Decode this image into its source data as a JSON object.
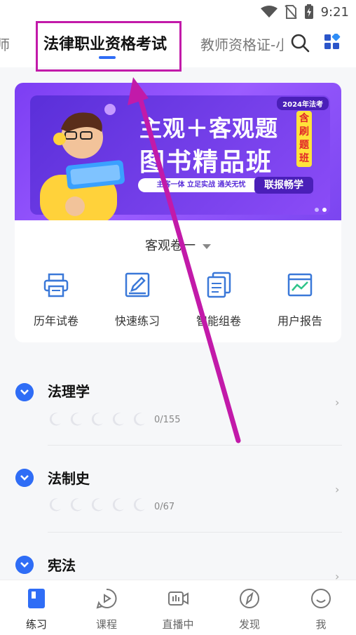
{
  "status_bar": {
    "time": "9:21"
  },
  "tabs": {
    "left_partial": "师",
    "active": "法律职业资格考试",
    "right_partial": "教师资格证-小"
  },
  "banner": {
    "tag": "2024年法考",
    "line1": "主观＋客观题",
    "line2": "图书精品班",
    "badge": "含刷题班",
    "subline": "主客一体 立足实战 通关无忧",
    "cta": "联报畅学"
  },
  "selector": {
    "label": "客观卷一"
  },
  "tools": [
    {
      "label": "历年试卷",
      "icon": "printer-icon"
    },
    {
      "label": "快速练习",
      "icon": "edit-icon"
    },
    {
      "label": "智能组卷",
      "icon": "documents-icon"
    },
    {
      "label": "用户报告",
      "icon": "chart-report-icon"
    }
  ],
  "subjects": [
    {
      "title": "法理学",
      "count": "0/155",
      "progress": 0
    },
    {
      "title": "法制史",
      "count": "0/67",
      "progress": 0
    },
    {
      "title": "宪法",
      "count": "",
      "progress": 0
    }
  ],
  "bottom_nav": [
    {
      "label": "练习",
      "icon": "book-icon",
      "active": true
    },
    {
      "label": "课程",
      "icon": "play-icon",
      "active": false
    },
    {
      "label": "直播中",
      "icon": "live-video-icon",
      "active": false
    },
    {
      "label": "发现",
      "icon": "compass-icon",
      "active": false
    },
    {
      "label": "我",
      "icon": "smile-icon",
      "active": false
    }
  ],
  "colors": {
    "accent": "#2f6df6",
    "annotation": "#c21aa9",
    "banner": "#7c3ef3"
  }
}
